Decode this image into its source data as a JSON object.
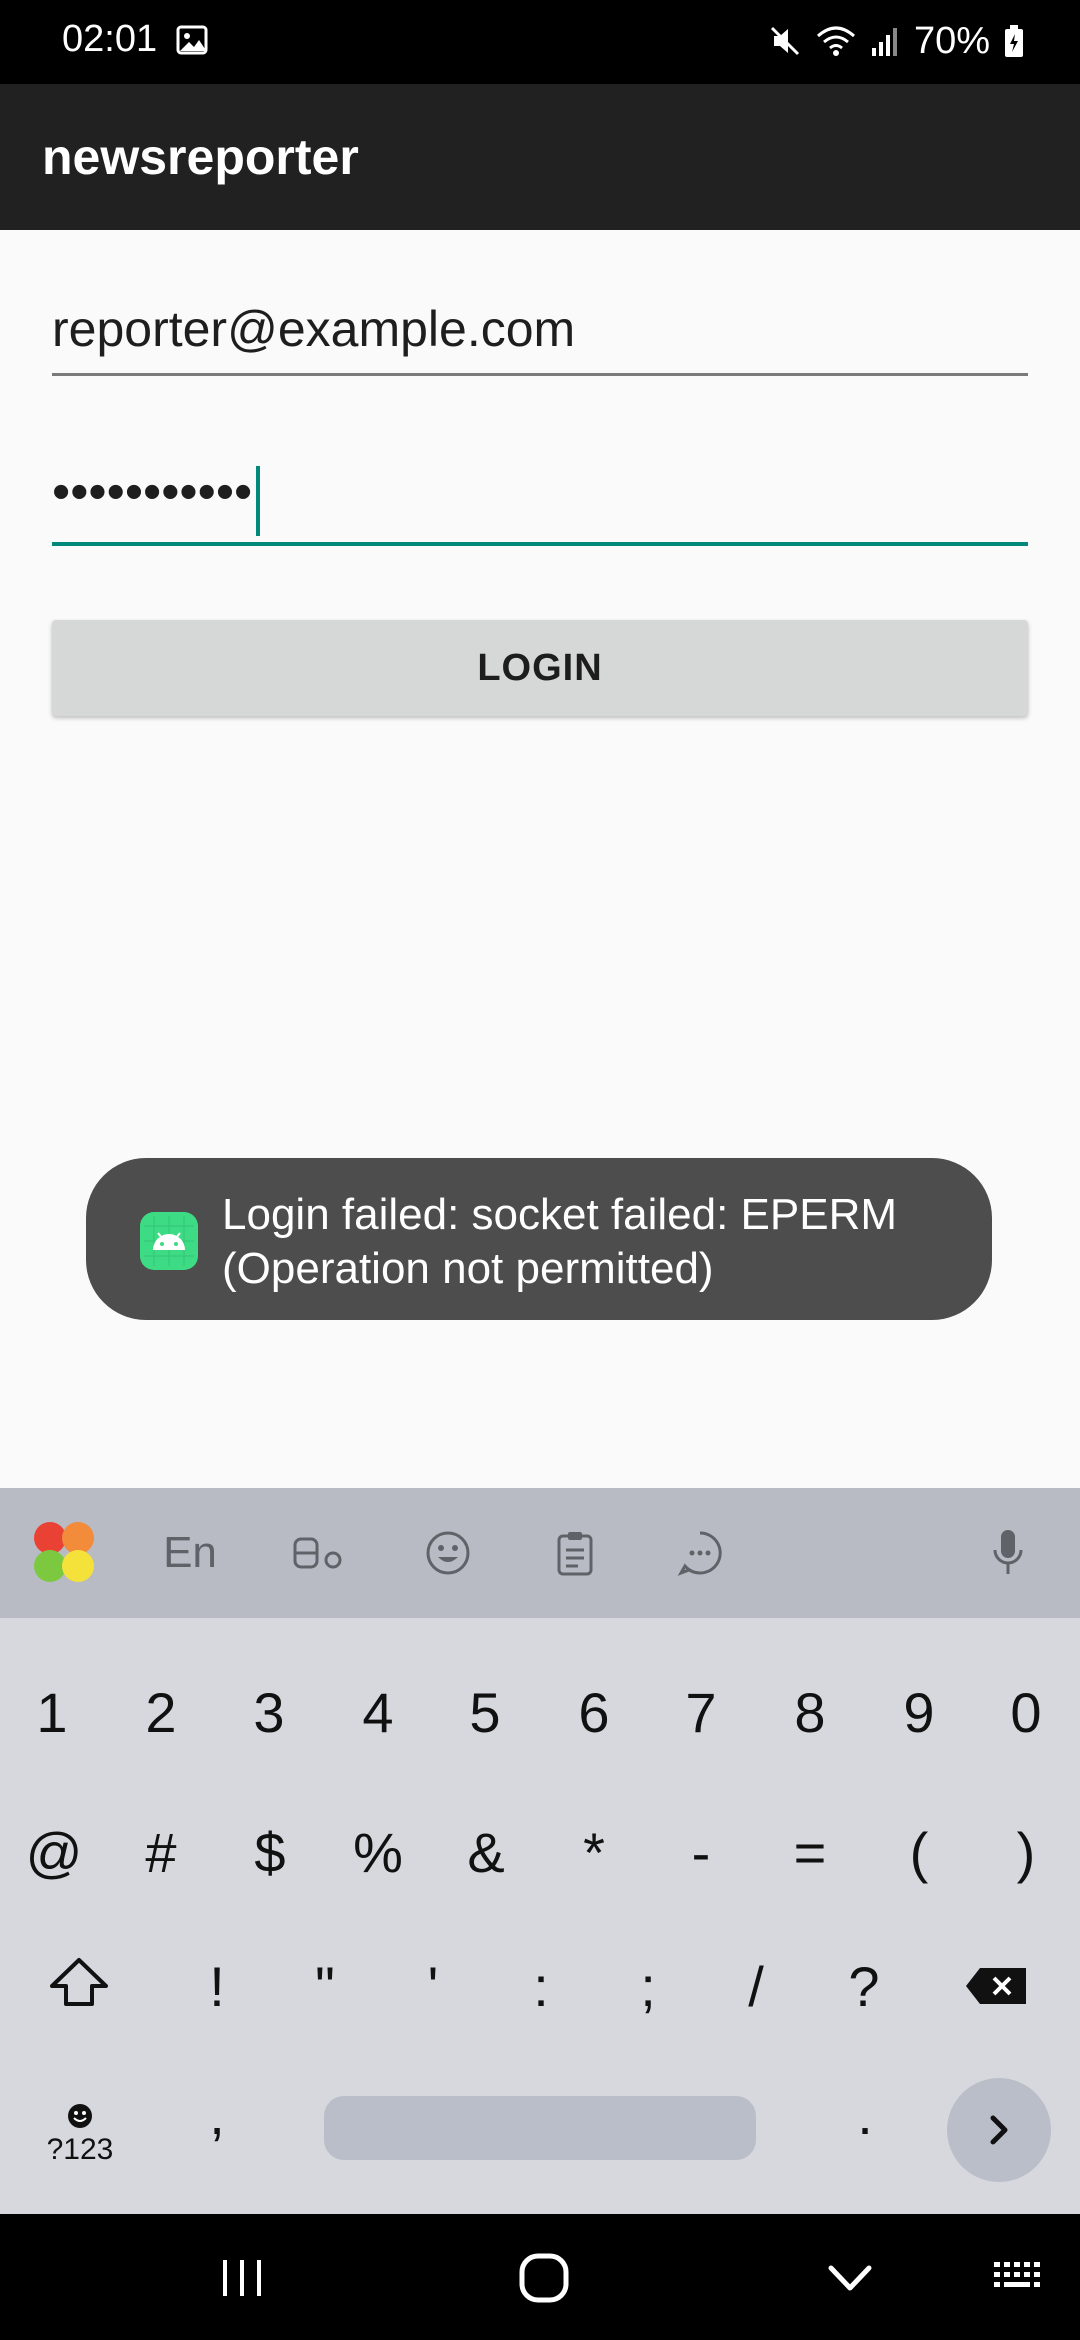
{
  "status_bar": {
    "time": "02:01",
    "battery": "70%",
    "icons": [
      "gallery-icon",
      "mute-icon",
      "wifi-icon",
      "signal-icon",
      "battery-icon"
    ]
  },
  "app_bar": {
    "title": "newsreporter"
  },
  "form": {
    "email_value": "reporter@example.com",
    "password_value": "•••••••••••",
    "login_label": "LOGIN"
  },
  "toast": {
    "message": "Login failed: socket failed: EPERM (Operation not permitted)",
    "icon": "android-icon"
  },
  "keyboard": {
    "toolbar": {
      "language": "En",
      "icons": [
        "samsung-apps-icon",
        "text-edit-icon",
        "emoji-icon",
        "clipboard-icon",
        "more-icon",
        "microphone-icon"
      ]
    },
    "row1": [
      "1",
      "2",
      "3",
      "4",
      "5",
      "6",
      "7",
      "8",
      "9",
      "0"
    ],
    "row2": [
      "@",
      "#",
      "$",
      "%",
      "&",
      "*",
      "-",
      "=",
      "(",
      ")"
    ],
    "row3": [
      "!",
      "\"",
      "'",
      ":",
      ";",
      "/",
      "?"
    ],
    "row4": {
      "symbols_label": "?123",
      "comma": ",",
      "period": "."
    },
    "colors": {
      "toolbar": "#b8bbc4",
      "keys_bg": "#d7d8de"
    }
  },
  "nav_bar": {
    "icons": [
      "recents-icon",
      "home-icon",
      "back-icon",
      "keyboard-icon"
    ]
  },
  "colors": {
    "accent": "#00897b",
    "app_bar": "#212121",
    "toast": "#4d4d4d"
  }
}
